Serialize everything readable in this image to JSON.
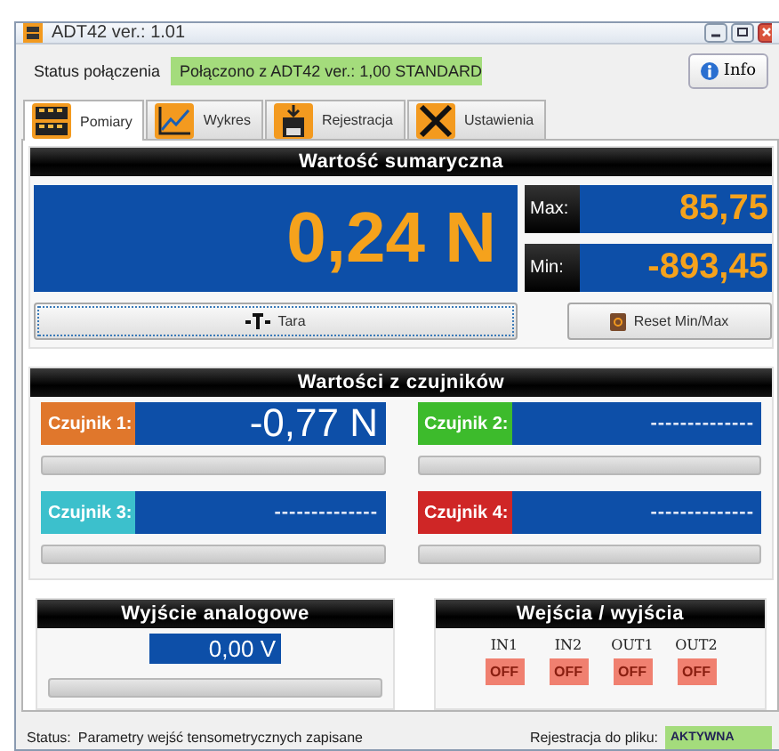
{
  "window": {
    "title": "ADT42 ver.: 1.01"
  },
  "connection": {
    "label": "Status połączenia",
    "value": "Połączono z ADT42 ver.: 1,00 STANDARD",
    "info_button": "Info"
  },
  "tabs": [
    {
      "label": "Pomiary",
      "selected": true,
      "kind": "display"
    },
    {
      "label": "Wykres",
      "selected": false,
      "kind": "chart"
    },
    {
      "label": "Rejestracja",
      "selected": false,
      "kind": "save"
    },
    {
      "label": "Ustawienia",
      "selected": false,
      "kind": "tools"
    }
  ],
  "total": {
    "title": "Wartość sumaryczna",
    "value": "0,24 N",
    "max_label": "Max:",
    "max_value": "85,75",
    "min_label": "Min:",
    "min_value": "-893,45",
    "tare_button": "Tara",
    "reset_button": "Reset Min/Max"
  },
  "sensors": {
    "title": "Wartości z czujników",
    "items": [
      {
        "label": "Czujnik 1:",
        "value": "-0,77 N",
        "color": "#e0772c",
        "level": 0
      },
      {
        "label": "Czujnik 2:",
        "value": "--------------",
        "color": "#3dbb2c",
        "level": 0
      },
      {
        "label": "Czujnik 3:",
        "value": "--------------",
        "color": "#3cc0cc",
        "level": 0
      },
      {
        "label": "Czujnik 4:",
        "value": "--------------",
        "color": "#cf2626",
        "level": 0
      }
    ]
  },
  "analog_output": {
    "title": "Wyjście analogowe",
    "value": "0,00 V",
    "level": 0
  },
  "io": {
    "title": "Wejścia / wyjścia",
    "items": [
      {
        "label": "IN1",
        "state": "OFF",
        "on": false
      },
      {
        "label": "IN2",
        "state": "OFF",
        "on": false
      },
      {
        "label": "OUT1",
        "state": "OFF",
        "on": false
      },
      {
        "label": "OUT2",
        "state": "OFF",
        "on": false
      }
    ]
  },
  "status_bar": {
    "label": "Status:",
    "message": "Parametry wejść tensometrycznych zapisane",
    "logging_label": "Rejestracja do pliku:",
    "logging_value": "AKTYWNA"
  }
}
